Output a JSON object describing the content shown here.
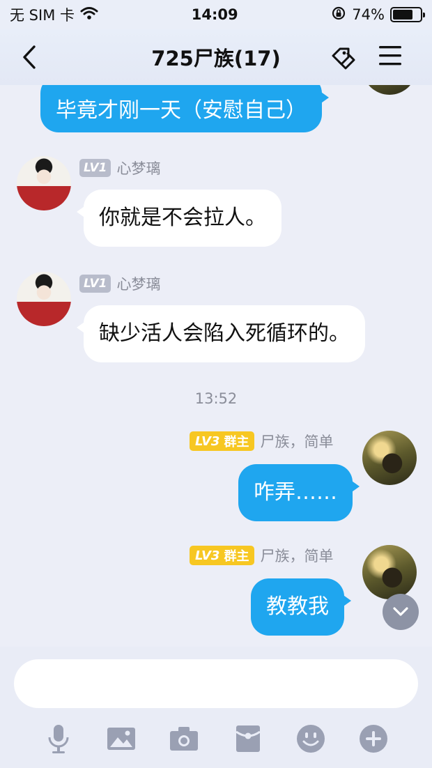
{
  "status_bar": {
    "carrier": "无 SIM 卡",
    "time": "14:09",
    "battery": "74%",
    "battery_level": 0.74
  },
  "nav": {
    "title": "725尸族(17)",
    "icons": [
      "back-icon",
      "tag-icon",
      "menu-icon"
    ]
  },
  "messages": [
    {
      "side": "self",
      "text": "毕竟才刚一天（安慰自己）"
    },
    {
      "side": "other",
      "level": "LV1",
      "name": "心梦璃",
      "text": "你就是不会拉人。"
    },
    {
      "side": "other",
      "level": "LV1",
      "name": "心梦璃",
      "text": "缺少活人会陷入死循环的。"
    },
    {
      "type": "time",
      "text": "13:52"
    },
    {
      "side": "self",
      "level": "LV3",
      "role": "群主",
      "name": "尸族，简单",
      "text": "咋弄……"
    },
    {
      "side": "self",
      "level": "LV3",
      "role": "群主",
      "name": "尸族，简单",
      "text": "教教我"
    }
  ],
  "input": {
    "value": "",
    "placeholder": ""
  },
  "toolbar": [
    "microphone-icon",
    "image-icon",
    "camera-icon",
    "red-packet-icon",
    "emoji-icon",
    "plus-icon"
  ],
  "colors": {
    "self_bubble": "#1fa6ef",
    "other_bubble": "#ffffff",
    "role_badge": "#f7c722",
    "level_badge": "#b8bccb"
  }
}
